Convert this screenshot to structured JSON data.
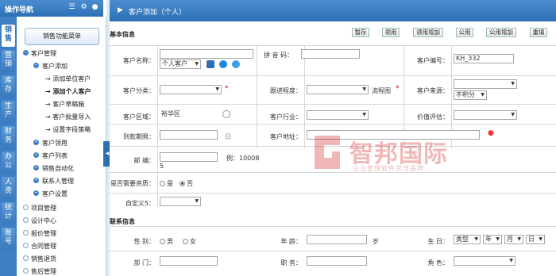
{
  "nav": {
    "title": "操作导航",
    "vtabs": [
      "销售",
      "营销",
      "库存",
      "生产",
      "财务",
      "办公",
      "人资",
      "统计",
      "账号"
    ],
    "menu_button": "销售功能菜单",
    "tree": [
      {
        "label": "客户管理",
        "level": 0,
        "open": true
      },
      {
        "label": "客户添加",
        "level": 1,
        "open": true
      },
      {
        "label": "添加单位客户",
        "level": 2
      },
      {
        "label": "添加个人客户",
        "level": 2
      },
      {
        "label": "客户草稿箱",
        "level": 2
      },
      {
        "label": "客户批量导入",
        "level": 2
      },
      {
        "label": "设置字段策略",
        "level": 2
      },
      {
        "label": "客户领用",
        "level": 1
      },
      {
        "label": "客户列表",
        "level": 1
      },
      {
        "label": "销售自动化",
        "level": 1
      },
      {
        "label": "联系人管理",
        "level": 1
      },
      {
        "label": "客户设置",
        "level": 1
      },
      {
        "label": "项目管理",
        "level": 0
      },
      {
        "label": "设计中心",
        "level": 0
      },
      {
        "label": "报价管理",
        "level": 0
      },
      {
        "label": "合同管理",
        "level": 0
      },
      {
        "label": "销售退货",
        "level": 0
      },
      {
        "label": "售后管理",
        "level": 0
      }
    ]
  },
  "header": {
    "title": "客户添加（个人）"
  },
  "toolbar": {
    "section": "基本信息",
    "buttons": [
      "暂存",
      "领用",
      "领用增加",
      "公用",
      "公用增加",
      "重填"
    ]
  },
  "form": {
    "name_label": "客户名称：",
    "name_type": "个人客户",
    "pinyin_label": "拼 音 码：",
    "code_label": "客户编号：",
    "code_value": "KH_332",
    "category_label": "客户分类：",
    "follow_label": "跟进程度：",
    "flow_label": "流程图",
    "source_label": "客户来源：",
    "source_points": "不积分",
    "region_label": "客户区域：",
    "region_value": "裕华区",
    "industry_label": "客户行业：",
    "value_label": "价值评估：",
    "payment_label": "到款期限：",
    "address_label": "客户地址：",
    "postcode_label": "邮 编：",
    "postcode_hint": "例：10008",
    "postcode_hint2": "5",
    "qual_label": "是否需要资质：",
    "qual_yes": "是",
    "qual_no": "否",
    "custom5_label": "自定义5："
  },
  "contact": {
    "section": "联系信息",
    "gender_label": "性 别：",
    "male": "男",
    "female": "女",
    "age_label": "年 龄：",
    "age_unit": "岁",
    "birthday_label": "生 日：",
    "bday_type": "类型",
    "bday_year": "年",
    "bday_month": "月",
    "bday_day": "日",
    "dept_label": "部 门：",
    "duty_label": "职 务：",
    "role_label": "角 色："
  },
  "watermark": {
    "cn": "智邦国际",
    "en": "企业管理软件领导品牌"
  }
}
